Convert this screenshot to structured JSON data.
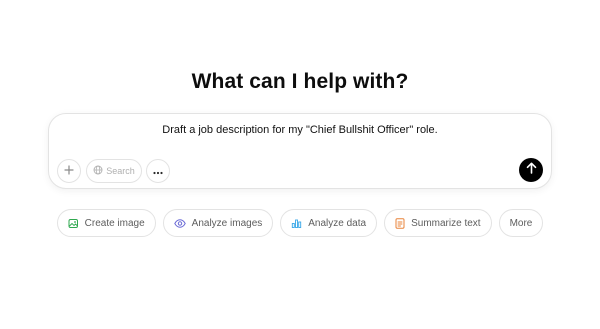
{
  "heading": "What can I help with?",
  "composer": {
    "input_value": "Draft a job description for my \"Chief Bullshit Officer\" role.",
    "search_label": "Search"
  },
  "chips": [
    {
      "label": "Create image",
      "icon": "image-icon",
      "color": "#2fa84f"
    },
    {
      "label": "Analyze images",
      "icon": "eye-icon",
      "color": "#6b6bd6"
    },
    {
      "label": "Analyze data",
      "icon": "bar-chart-icon",
      "color": "#35a6e8"
    },
    {
      "label": "Summarize text",
      "icon": "document-icon",
      "color": "#e8833a"
    },
    {
      "label": "More"
    }
  ]
}
